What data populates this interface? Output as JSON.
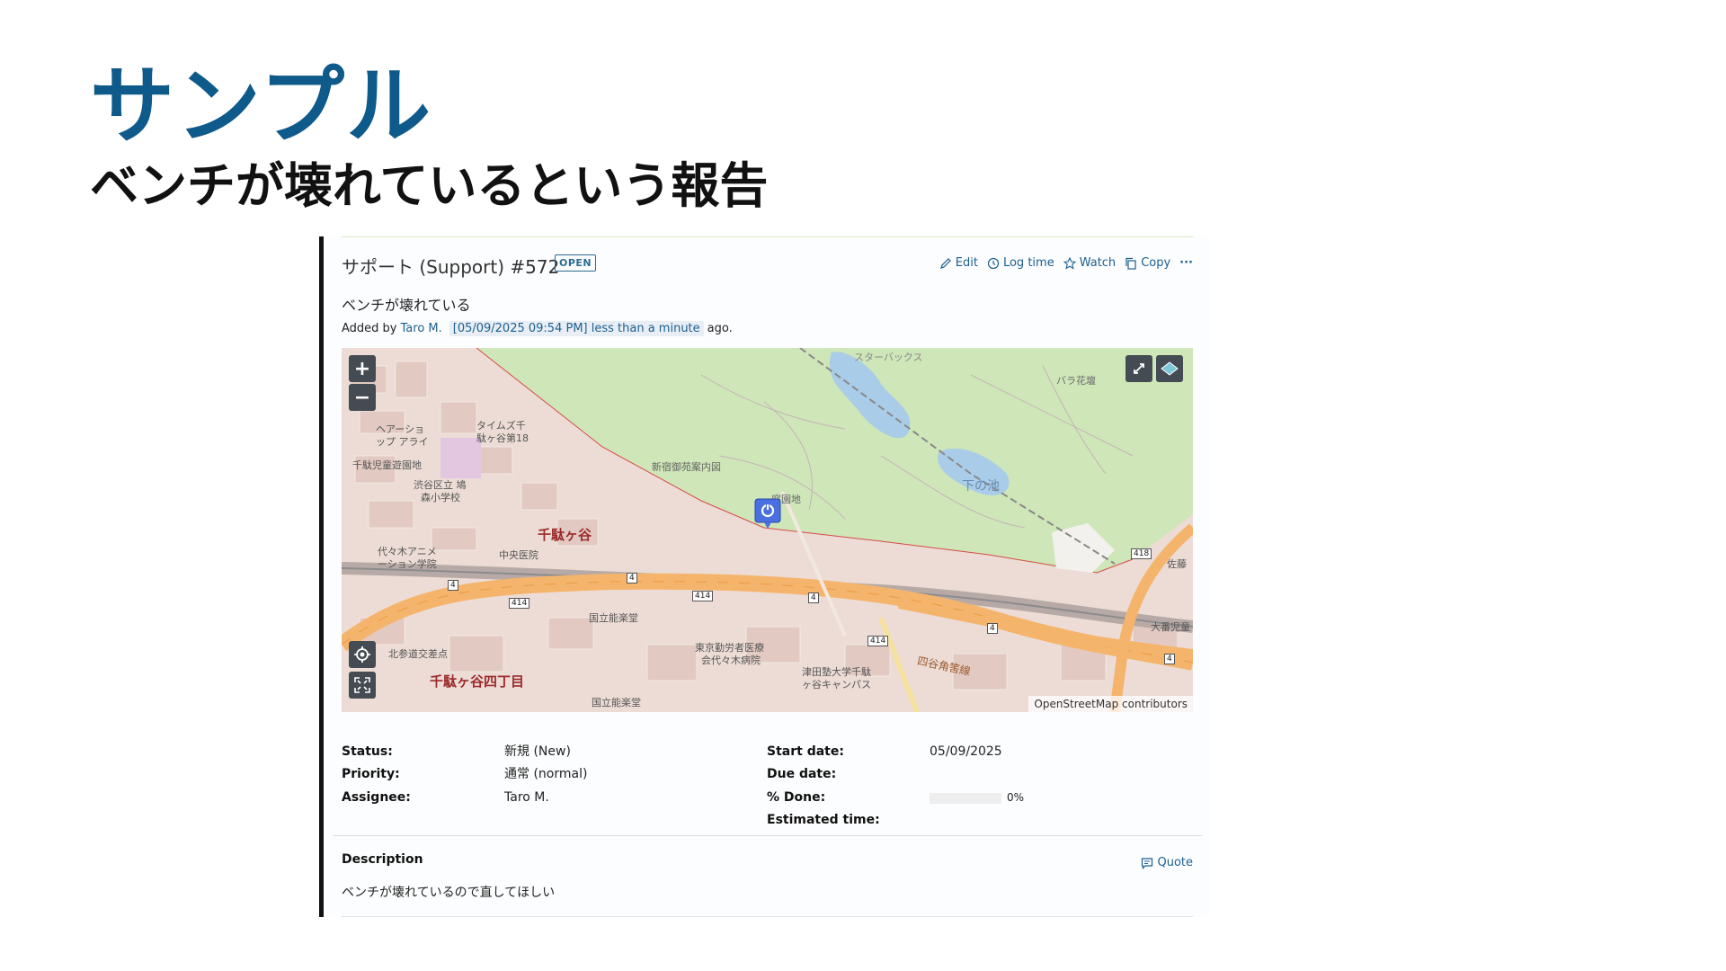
{
  "slide": {
    "title": "サンプル",
    "subtitle": "ベンチが壊れているという報告"
  },
  "issue": {
    "title": "サポート (Support) #572",
    "status_badge": "OPEN",
    "subject": "ベンチが壊れている",
    "added_by_prefix": "Added by",
    "author": "Taro M.",
    "timestamp": "[05/09/2025 09:54 PM] less than a minute",
    "added_suffix": "ago."
  },
  "actions": {
    "edit": "Edit",
    "log_time": "Log time",
    "watch": "Watch",
    "copy": "Copy",
    "more": "···"
  },
  "map": {
    "zoom_in": "+",
    "zoom_out": "−",
    "attribution": "OpenStreetMap contributors",
    "labels": {
      "starbucks": "スターバックス",
      "rose_garden": "バラ花壇",
      "hair_shop": "ヘアーショ",
      "hair_shop2": "ップ アライ",
      "times": "タイムズ千",
      "times2": "駄ヶ谷第18",
      "park": "千駄児童遊園地",
      "school": "渋谷区立 鳩",
      "school2": "森小学校",
      "guide": "新宿御苑案内図",
      "garden": "庭園地",
      "pond": "下の池",
      "sendagaya": "千駄ヶ谷",
      "anime": "代々木アニメ",
      "anime2": "ーション学院",
      "hospital": "中央医院",
      "noh": "国立能楽堂",
      "hospital2": "東京勤労者医療",
      "hospital2b": "会代々木病院",
      "kitasando": "北参道交差点",
      "sendagaya4": "千駄ヶ谷四丁目",
      "noh2": "国立能楽堂",
      "tsuda": "津田塾大学千駄",
      "tsuda2": "ヶ谷キャンパス",
      "shikaku": "四谷角筈線",
      "daibanchi": "大番児童",
      "sato": "佐藤",
      "r414a": "414",
      "r414b": "414",
      "r414c": "414",
      "r418": "418",
      "r4a": "4",
      "r4b": "4",
      "r4c": "4",
      "r4d": "4",
      "r4e": "4"
    }
  },
  "properties": {
    "status_label": "Status:",
    "status_value": "新規 (New)",
    "priority_label": "Priority:",
    "priority_value": "通常 (normal)",
    "assignee_label": "Assignee:",
    "assignee_value": "Taro M.",
    "start_label": "Start date:",
    "start_value": "05/09/2025",
    "due_label": "Due date:",
    "done_label": "% Done:",
    "done_value": "0%",
    "done_fraction": 0,
    "estimated_label": "Estimated time:"
  },
  "description": {
    "heading": "Description",
    "quote": "Quote",
    "text": "ベンチが壊れているので直してほしい"
  },
  "colors": {
    "title_blue": "#0e5a8a",
    "link_blue": "#1b5f8f",
    "map_green": "#cfe6b8",
    "map_urban": "#eadfd8",
    "road_orange": "#f5b46b"
  }
}
